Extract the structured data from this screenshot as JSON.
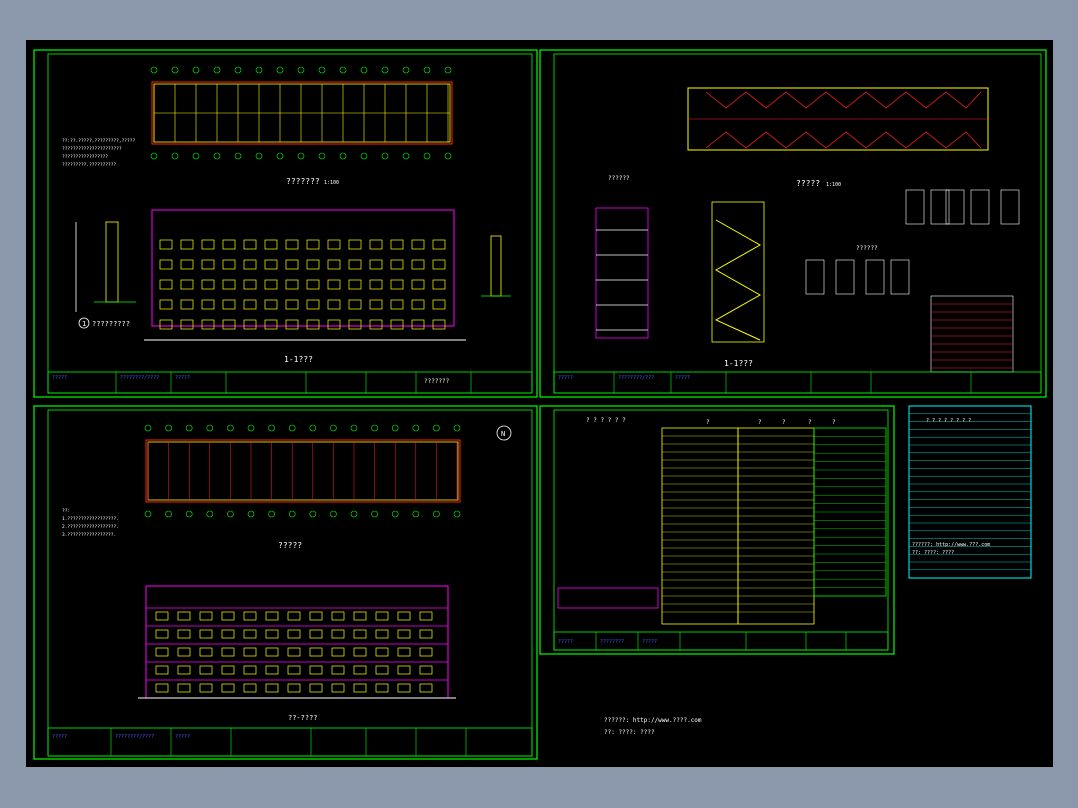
{
  "colors": {
    "background": "#8b98ab",
    "canvas": "#000000",
    "frame": "#00ff00",
    "wall": "#ffff00",
    "column": "#ff00ff",
    "grid": "#ff2020",
    "text": "#ffffff",
    "cyan": "#00ffff",
    "titleblock_text": "#4060ff"
  },
  "sheet1": {
    "plan_title": "??????? ",
    "plan_scale": "1:100",
    "elev_title": "1-1???",
    "detail_label": "?????????",
    "detail_num": "1",
    "note_lines": [
      "??:??.?????,?????????,?????",
      "??????????????????????",
      "?????????????????",
      "?????????.??????????"
    ],
    "tb_cells": [
      "?????",
      "????????/????",
      "?????"
    ],
    "tb_code": "???????"
  },
  "sheet2": {
    "plan_title": "????? ",
    "plan_scale": "1:100",
    "section_title": "1-1???",
    "stair_title": "??????",
    "door_title": "??????",
    "table_head": [
      "??",
      "??",
      "??",
      "??",
      "??",
      "??"
    ],
    "tb_cells": [
      "?????",
      "????????/???",
      "?????"
    ]
  },
  "sheet3": {
    "plan_title": "?????",
    "elev_title": "??-????",
    "north": "N",
    "note_lines": [
      "??:",
      "1.??????????????????.",
      "2.??????????????????.",
      "3.?????????????????."
    ],
    "tb_cells": [
      "?????",
      "????????/????",
      "?????"
    ]
  },
  "sheet4": {
    "header": "? ? ? ? ? ?",
    "col_heads": [
      "?",
      "?",
      "?",
      "?",
      "?"
    ],
    "tb_cells": [
      "?????",
      "????????",
      "?????"
    ]
  },
  "sheet5": {
    "header": "? ? ? ? ? ? ? ?",
    "footer_lines": [
      "??????:  http://www.???.com",
      "??:  ????: ????"
    ]
  },
  "watermark_lines": [
    "??????:  http://www.????.com",
    "??:  ????: ????"
  ]
}
